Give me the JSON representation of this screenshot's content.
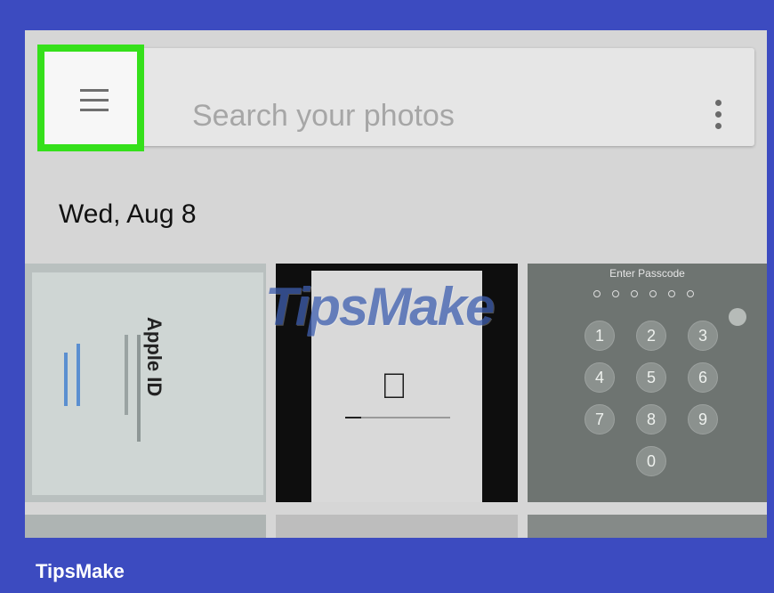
{
  "search": {
    "placeholder": "Search your photos"
  },
  "section": {
    "date": "Wed, Aug 8"
  },
  "photos": {
    "apple_id_title": "Apple ID",
    "passcode_prompt": "Enter Passcode",
    "keys": [
      "1",
      "2",
      "3",
      "4",
      "5",
      "6",
      "7",
      "8",
      "9",
      "0"
    ],
    "progress_fraction": 0.15
  },
  "watermark": "TipsMake",
  "brand": "TipsMake",
  "colors": {
    "background": "#3c4bc0",
    "highlight": "#35e01b"
  },
  "icons": {
    "menu": "hamburger-menu-icon",
    "more": "kebab-menu-icon",
    "apple": "apple-logo-icon"
  }
}
